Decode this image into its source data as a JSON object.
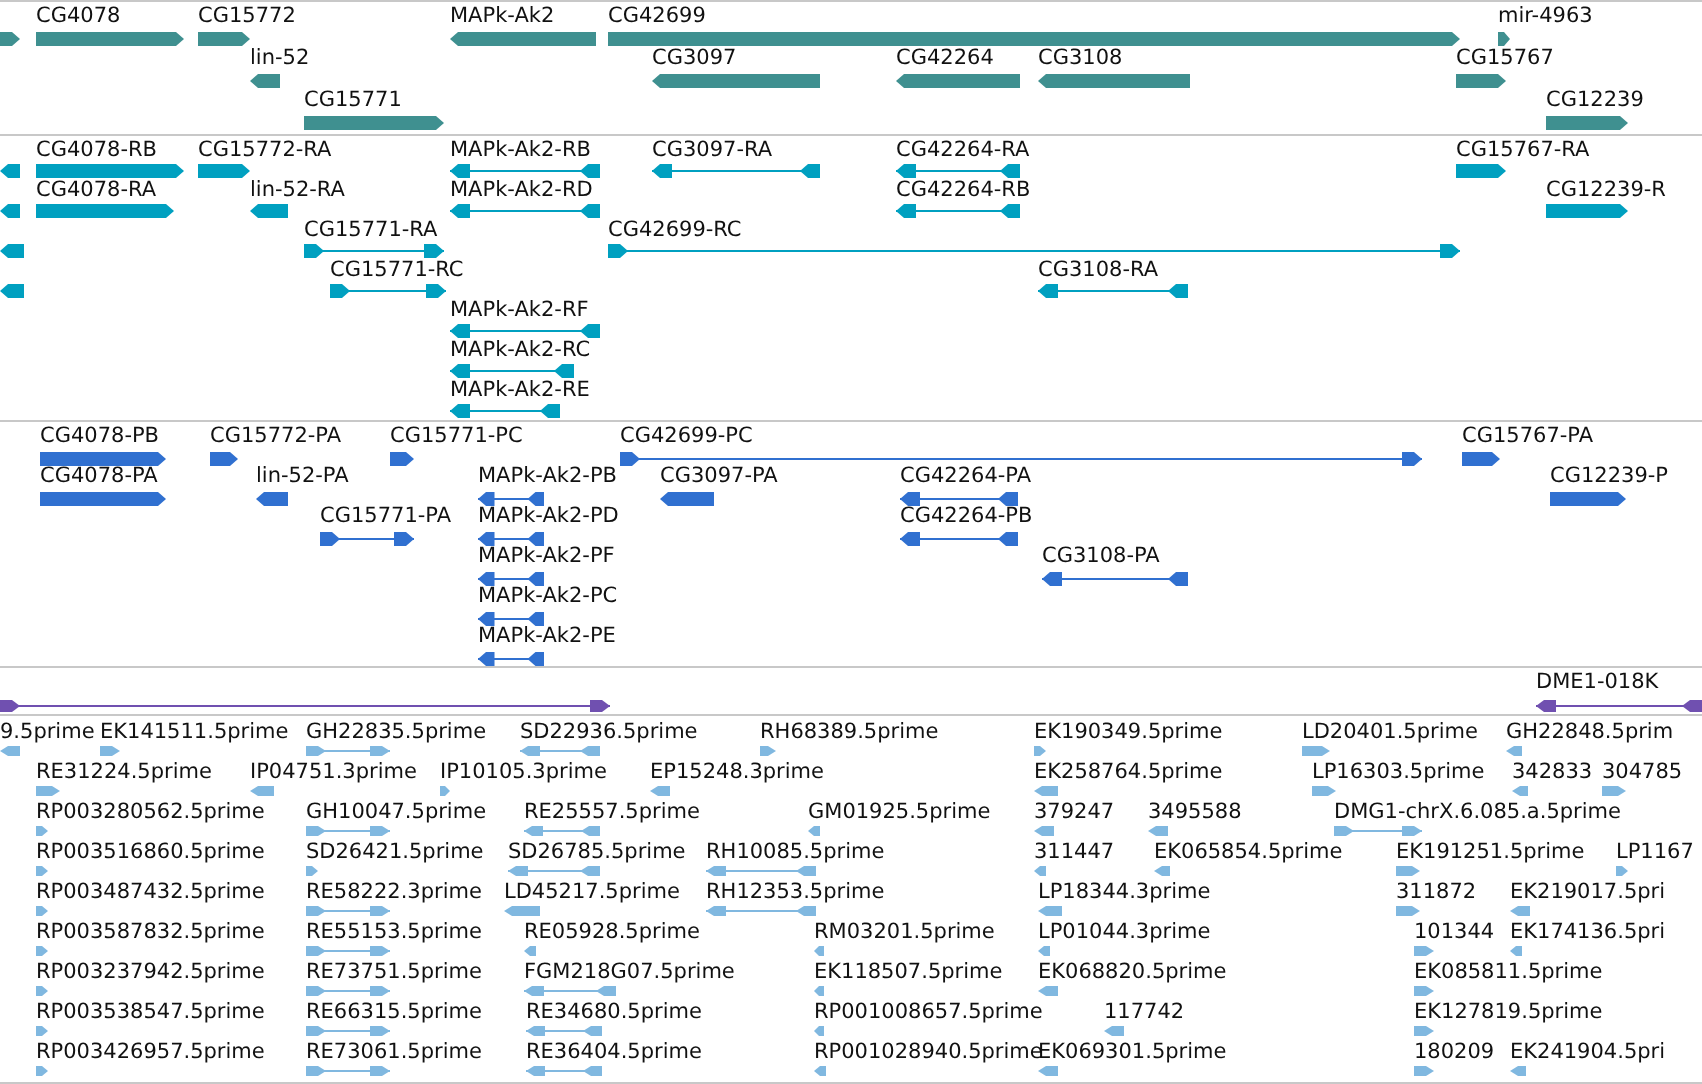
{
  "tracks": [
    {
      "kind": "gene",
      "color": "#3f9090",
      "features": [
        {
          "reverse": false
        },
        {
          "label": "CG4078",
          "reverse": false
        },
        {
          "label": "CG15772",
          "reverse": false
        },
        {
          "label": "MAPk-Ak2",
          "reverse": true
        },
        {
          "label": "CG42699",
          "reverse": false
        },
        {
          "label": "mir-4963",
          "reverse": false
        },
        {
          "label": "lin-52",
          "reverse": true
        },
        {
          "label": "CG3097",
          "reverse": true
        },
        {
          "label": "CG42264",
          "reverse": true
        },
        {
          "label": "CG3108",
          "reverse": true
        },
        {
          "label": "CG15767",
          "reverse": false
        },
        {
          "label": "CG15771",
          "reverse": false
        },
        {
          "label": "CG12239",
          "reverse": false
        }
      ]
    },
    {
      "kind": "transcript",
      "color": "#00a0c0",
      "features": [
        {
          "reverse": true
        },
        {
          "label": "CG4078-RB",
          "reverse": false
        },
        {
          "label": "CG15772-RA",
          "reverse": false
        },
        {
          "label": "MAPk-Ak2-RB",
          "reverse": true
        },
        {
          "label": "CG3097-RA",
          "reverse": true
        },
        {
          "label": "CG42264-RA",
          "reverse": true
        },
        {
          "label": "CG15767-RA",
          "reverse": false
        },
        {
          "reverse": true
        },
        {
          "label": "CG4078-RA",
          "reverse": false
        },
        {
          "label": "lin-52-RA",
          "reverse": true
        },
        {
          "label": "MAPk-Ak2-RD",
          "reverse": true
        },
        {
          "label": "CG42264-RB",
          "reverse": true
        },
        {
          "label": "CG12239-R",
          "reverse": false
        },
        {
          "reverse": true
        },
        {
          "label": "CG15771-RA",
          "reverse": false
        },
        {
          "label": "CG42699-RC",
          "reverse": false
        },
        {
          "reverse": true
        },
        {
          "label": "CG15771-RC",
          "reverse": false
        },
        {
          "label": "CG3108-RA",
          "reverse": true
        },
        {
          "label": "MAPk-Ak2-RF",
          "reverse": true
        },
        {
          "label": "MAPk-Ak2-RC",
          "reverse": true
        },
        {
          "label": "MAPk-Ak2-RE",
          "reverse": true
        }
      ]
    },
    {
      "kind": "protein",
      "color": "#3070d0",
      "features": [
        {
          "label": "CG4078-PB",
          "reverse": false
        },
        {
          "label": "CG15772-PA",
          "reverse": false
        },
        {
          "label": "CG15771-PC",
          "reverse": false
        },
        {
          "label": "CG42699-PC",
          "reverse": false
        },
        {
          "label": "CG15767-PA",
          "reverse": false
        },
        {
          "label": "CG4078-PA",
          "reverse": false
        },
        {
          "label": "lin-52-PA",
          "reverse": true
        },
        {
          "label": "MAPk-Ak2-PB",
          "reverse": true
        },
        {
          "label": "CG3097-PA",
          "reverse": true
        },
        {
          "label": "CG42264-PA",
          "reverse": true
        },
        {
          "label": "CG12239-P",
          "reverse": false
        },
        {
          "label": "CG15771-PA",
          "reverse": false
        },
        {
          "label": "MAPk-Ak2-PD",
          "reverse": true
        },
        {
          "label": "CG42264-PB",
          "reverse": true
        },
        {
          "label": "MAPk-Ak2-PF",
          "reverse": true
        },
        {
          "label": "CG3108-PA",
          "reverse": true
        },
        {
          "label": "MAPk-Ak2-PC",
          "reverse": true
        },
        {
          "label": "MAPk-Ak2-PE",
          "reverse": true
        }
      ]
    },
    {
      "kind": "match",
      "color": "#7050b0",
      "features": [
        {
          "reverse": false
        },
        {
          "label": "DME1-018K",
          "reverse": true
        }
      ]
    },
    {
      "kind": "est",
      "color": "#80b8e0",
      "features": [
        {
          "label": "9.5prime",
          "reverse": true
        },
        {
          "label": "EK141511.5prime",
          "reverse": false
        },
        {
          "label": "GH22835.5prime",
          "reverse": false
        },
        {
          "label": "SD22936.5prime",
          "reverse": true
        },
        {
          "label": "RH68389.5prime",
          "reverse": false
        },
        {
          "label": "EK190349.5prime",
          "reverse": false
        },
        {
          "label": "LD20401.5prime",
          "reverse": false
        },
        {
          "label": "GH22848.5prim",
          "reverse": true
        },
        {
          "label": "RE31224.5prime",
          "reverse": false
        },
        {
          "label": "IP04751.3prime",
          "reverse": true
        },
        {
          "label": "IP10105.3prime",
          "reverse": false
        },
        {
          "label": "EP15248.3prime",
          "reverse": true
        },
        {
          "label": "EK258764.5prime",
          "reverse": true
        },
        {
          "label": "LP16303.5prime",
          "reverse": false
        },
        {
          "label": "342833",
          "reverse": true
        },
        {
          "label": "304785",
          "reverse": false
        },
        {
          "label": "RP003280562.5prime",
          "reverse": false
        },
        {
          "label": "GH10047.5prime",
          "reverse": false
        },
        {
          "label": "RE25557.5prime",
          "reverse": true
        },
        {
          "label": "GM01925.5prime",
          "reverse": true
        },
        {
          "label": "379247",
          "reverse": true
        },
        {
          "label": "3495588",
          "reverse": true
        },
        {
          "label": "DMG1-chrX.6.085.a.5prime",
          "reverse": false
        },
        {
          "label": "RP003516860.5prime",
          "reverse": false
        },
        {
          "label": "SD26421.5prime",
          "reverse": false
        },
        {
          "label": "SD26785.5prime",
          "reverse": true
        },
        {
          "label": "RH10085.5prime",
          "reverse": true
        },
        {
          "label": "311447",
          "reverse": true
        },
        {
          "label": "EK065854.5prime",
          "reverse": true
        },
        {
          "label": "EK191251.5prime",
          "reverse": false
        },
        {
          "label": "LP1167",
          "reverse": false
        },
        {
          "label": "RP003487432.5prime",
          "reverse": false
        },
        {
          "label": "RE58222.3prime",
          "reverse": false
        },
        {
          "label": "LD45217.5prime",
          "reverse": true
        },
        {
          "label": "RH12353.5prime",
          "reverse": true
        },
        {
          "label": "LP18344.3prime",
          "reverse": true
        },
        {
          "label": "311872",
          "reverse": false
        },
        {
          "label": "EK219017.5pri",
          "reverse": true
        },
        {
          "label": "RP003587832.5prime",
          "reverse": false
        },
        {
          "label": "RE55153.5prime",
          "reverse": false
        },
        {
          "label": "RE05928.5prime",
          "reverse": true
        },
        {
          "label": "RM03201.5prime",
          "reverse": true
        },
        {
          "label": "LP01044.3prime",
          "reverse": true
        },
        {
          "label": "101344",
          "reverse": false
        },
        {
          "label": "EK174136.5pri",
          "reverse": true
        },
        {
          "label": "RP003237942.5prime",
          "reverse": false
        },
        {
          "label": "RE73751.5prime",
          "reverse": false
        },
        {
          "label": "FGM218G07.5prime",
          "reverse": true
        },
        {
          "label": "EK118507.5prime",
          "reverse": true
        },
        {
          "label": "EK068820.5prime",
          "reverse": true
        },
        {
          "label": "EK085811.5prime",
          "reverse": false
        },
        {
          "label": "RP003538547.5prime",
          "reverse": false
        },
        {
          "label": "RE66315.5prime",
          "reverse": false
        },
        {
          "label": "RE34680.5prime",
          "reverse": true
        },
        {
          "label": "RP001008657.5prime",
          "reverse": true
        },
        {
          "label": "117742",
          "reverse": true
        },
        {
          "label": "EK127819.5prime",
          "reverse": false
        },
        {
          "label": "RP003426957.5prime",
          "reverse": false
        },
        {
          "label": "RE73061.5prime",
          "reverse": false
        },
        {
          "label": "RE36404.5prime",
          "reverse": true
        },
        {
          "label": "RP001028940.5prime",
          "reverse": true
        },
        {
          "label": "EK069301.5prime",
          "reverse": true
        },
        {
          "label": "180209",
          "reverse": false
        },
        {
          "label": "EK241904.5pri",
          "reverse": true
        }
      ]
    }
  ]
}
